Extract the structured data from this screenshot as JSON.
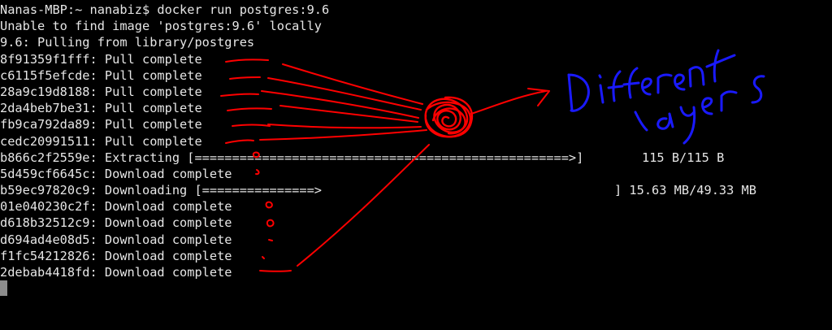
{
  "terminal": {
    "prompt_line": "Nanas-MBP:~ nanabiz$ docker run postgres:9.6",
    "unable_line": "Unable to find image 'postgres:9.6' locally",
    "pulling_line": "9.6: Pulling from library/postgres",
    "layers": [
      "8f91359f1fff: Pull complete",
      "c6115f5efcde: Pull complete",
      "28a9c19d8188: Pull complete",
      "2da4beb7be31: Pull complete",
      "fb9ca792da89: Pull complete",
      "cedc20991511: Pull complete",
      "b866c2f2559e: Extracting [==================================================>]",
      "5d459cf6645c: Download complete",
      "b59ec97820c9: Downloading [===============>",
      "01e040230c2f: Download complete",
      "d618b32512c9: Download complete",
      "d694ad4e08d5: Download complete",
      "f1fc54212826: Download complete",
      "2debab4418fd: Download complete"
    ],
    "extracting_size": "115 B/115 B",
    "downloading_size": "] 15.63 MB/49.33 MB",
    "colors": {
      "background": "#000000",
      "text": "#e6e6e6",
      "cursor": "#8c8c8c"
    }
  },
  "annotation": {
    "label_line1": "Different",
    "label_line2": "layers",
    "ink_red": "#ff0000",
    "ink_blue": "#1a1aff"
  }
}
